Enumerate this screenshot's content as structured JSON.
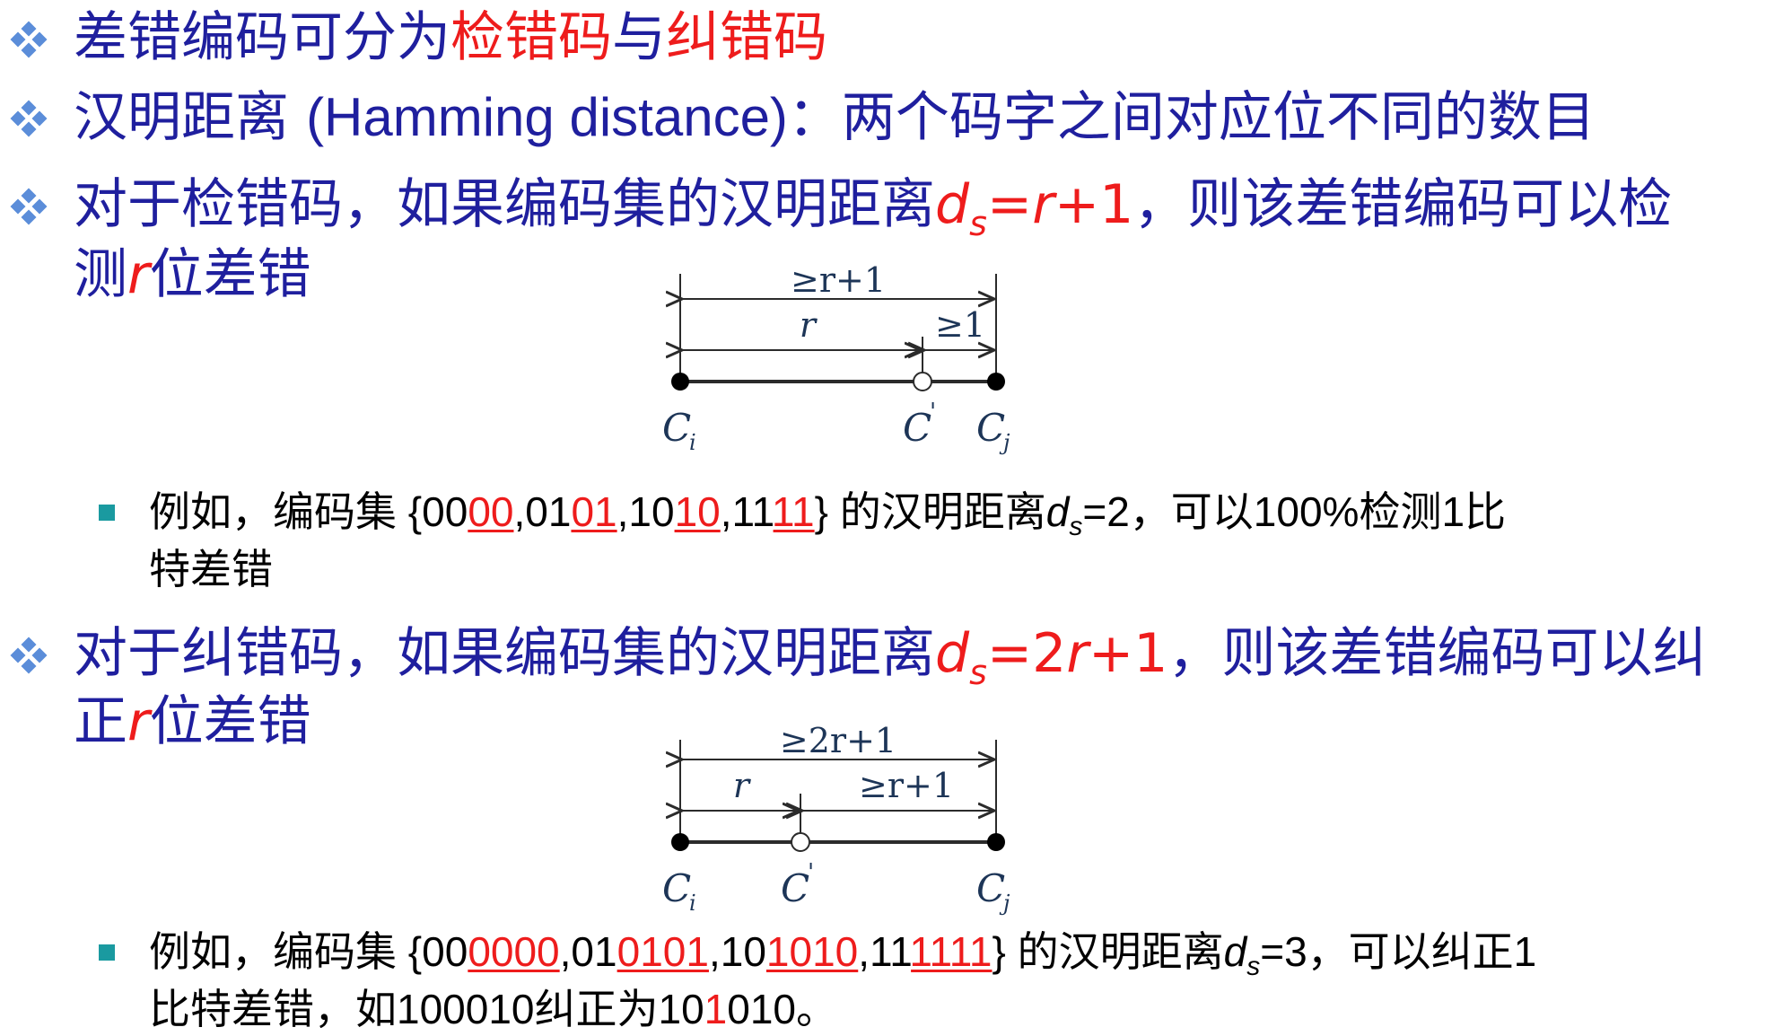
{
  "b1": {
    "t1": "差错编码可分为",
    "t2": "检错码",
    "t3": "与",
    "t4": "纠错码"
  },
  "b2": {
    "t1": "汉明距离 ",
    "t2": "(Hamming distance)",
    "t3": "：两个码字之间对应位不同的数目"
  },
  "b3": {
    "t1": "对于检错码，如果编码集的汉明距离",
    "d": "d",
    "s": "s",
    "eq": "=",
    "r": "r",
    "p": "+1",
    "t2": "，则该差错编码可以检",
    "t3": "测",
    "r2": "r",
    "t4": "位差错"
  },
  "ex1": {
    "t1": "例如，编码集 {00",
    "u1": "00",
    "c1": ",01",
    "u2": "01",
    "c2": ",10",
    "u3": "10",
    "c3": ",11",
    "u4": "11",
    "t2": "} 的汉明距离",
    "d": "d",
    "s": "s",
    "t3": "=2，可以100%检测1比",
    "t4": "特差错"
  },
  "b4": {
    "t1": "对于纠错码，如果编码集的汉明距离",
    "d": "d",
    "s": "s",
    "eq": "=2",
    "r": "r",
    "p": "+1",
    "t2": "，则该差错编码可以纠",
    "t3": "正",
    "r2": "r",
    "t4": "位差错"
  },
  "ex2": {
    "t1": "例如，编码集 {00",
    "u1": "0000",
    "c1": ",01",
    "u2": "0101",
    "c2": ",10",
    "u3": "1010",
    "c3": ",11",
    "u4": "1111",
    "t2": "} 的汉明距离",
    "d": "d",
    "s": "s",
    "t3": "=3，可以纠正1",
    "t4a": "比特差错，如100010纠正为10",
    "t4b": "1",
    "t4c": "010。"
  },
  "diagram1": {
    "top": "≥r+1",
    "left": "r",
    "right": "≥1",
    "ci": "C",
    "ci_sub": "i",
    "cp": "C",
    "cp_sup": "'",
    "cj": "C",
    "cj_sub": "j"
  },
  "diagram2": {
    "top": "≥2r+1",
    "left": "r",
    "right": "≥r+1",
    "ci": "C",
    "ci_sub": "i",
    "cp": "C",
    "cp_sup": "'",
    "cj": "C",
    "cj_sub": "j"
  },
  "colors": {
    "text": "#1f1f9e",
    "highlight": "#ee1c1c",
    "bullet": "#5b8dd9",
    "square": "#1a9aa0"
  },
  "icons": {
    "main_bullet": "diamond-bullet-icon",
    "sub_bullet": "square-bullet-icon"
  }
}
